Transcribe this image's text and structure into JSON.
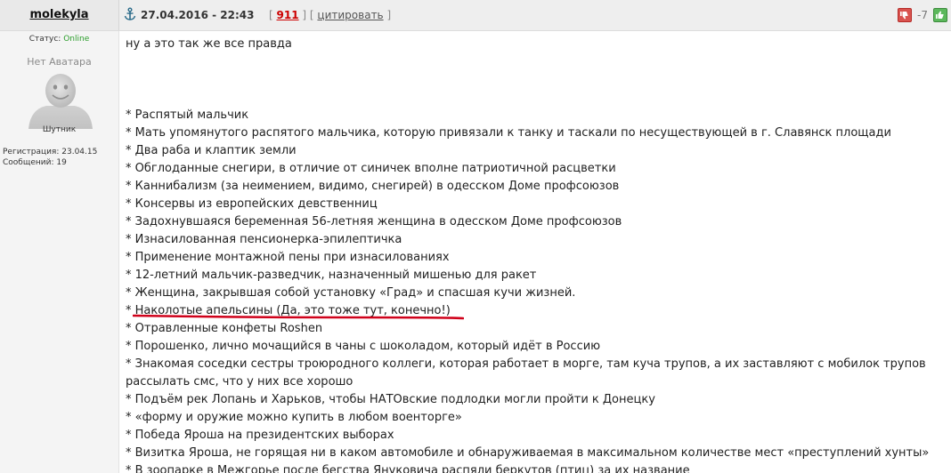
{
  "header": {
    "username": "molekyla",
    "anchor_icon": "anchor-icon",
    "date": "27.04.2016 - 22:43",
    "bracket_open": "[",
    "bracket_sep": "] [",
    "bracket_close": "]",
    "post_number": "911",
    "quote_label": "цитировать",
    "rating_value": "-7",
    "thumb_down_icon": "thumb-down-icon",
    "thumb_up_icon": "thumb-up-icon"
  },
  "sidebar": {
    "status_label": "Статус:",
    "status_value": "Online",
    "no_avatar_label": "Нет Аватара",
    "rank": "Шутник",
    "registration_label": "Регистрация:",
    "registration_value": "23.04.15",
    "messages_label": "Сообщений:",
    "messages_value": "19"
  },
  "post": {
    "intro": "ну а это так же все правда",
    "items": [
      "* Распятый мальчик",
      "* Мать упомянутого распятого мальчика, которую привязали к танку и таскали по несуществующей в г. Славянск площади",
      "* Два раба и клаптик земли",
      "* Обглоданные снегири, в отличие от синичек вполне патриотичной расцветки",
      "* Каннибализм (за неимением, видимо, снегирей) в одесском Доме профсоюзов",
      "* Консервы из европейских девственниц",
      "* Задохнувшаяся беременная 56-летняя женщина в одесском Доме профсоюзов",
      "* Изнасилованная пенсионерка-эпилептичка",
      "* Применение монтажной пены при изнасилованиях",
      "* 12-летний мальчик-разведчик, назначенный мишенью для ракет",
      "* Женщина, закрывшая собой установку «Град» и спасшая кучи жизней.",
      "* Наколотые апельсины (Да, это тоже тут, конечно!)",
      "* Отравленные конфеты Roshen",
      "* Порошенко, лично мочащийся в чаны с шоколадом, который идёт в Россию",
      "* Знакомая соседки сестры троюродного коллеги, которая работает в морге, там куча трупов, а их заставляют с мобилок трупов рассылать смс, что у них все хорошо",
      "* Подъём рек Лопань и Харьков, чтобы НАТОвские подлодки могли пройти к Донецку",
      "* «форму и оружие можно купить в любом военторге»",
      "* Победа Яроша на президентских выборах",
      "* Визитка Яроша, не горящая ни в каком автомобиле и обнаруживаемая в максимальном количестве мест «преступлений хунты»",
      "* В зоопарке в Межгорье после бегства Януковича распяли беркутов (птиц) за их название"
    ],
    "highlighted_index": 11,
    "highlight_color": "#d0021b"
  }
}
